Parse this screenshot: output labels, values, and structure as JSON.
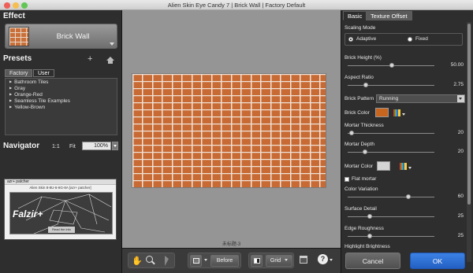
{
  "window": {
    "title": "Alien Skin Eye Candy 7 | Brick Wall | Factory Default"
  },
  "effect": {
    "heading": "Effect",
    "name": "Brick Wall"
  },
  "presets": {
    "heading": "Presets",
    "tabs": [
      "Factory",
      "User"
    ],
    "items": [
      "Bathroom Tiles",
      "Gray",
      "Orange-Red",
      "Seamless Tile Examples",
      "Yellow-Brown"
    ]
  },
  "navigator": {
    "heading": "Navigator",
    "zoom_1to1": "1:1",
    "fit": "Fit",
    "zoom_value": "100%"
  },
  "nav_thumb": {
    "title": "azr+ patcher",
    "subtitle": "Alien Skin 8-8U-6-6G-8A [azr+ patcher]",
    "logo": "Falzir+",
    "caption": "Read the info"
  },
  "canvas": {
    "zoom_label": "未标题-3"
  },
  "bottom_toolbar": {
    "before_label": "Before",
    "grid_label": "Grid"
  },
  "right_tabs": [
    "Basic",
    "Texture Offset"
  ],
  "scaling": {
    "label": "Scaling Mode",
    "adaptive": "Adaptive",
    "fixed": "Fixed",
    "selected": "Adaptive"
  },
  "params": {
    "brick_height": {
      "label": "Brick Height (%)",
      "value": "50.00"
    },
    "aspect_ratio": {
      "label": "Aspect Ratio",
      "value": "2.75"
    },
    "brick_pattern": {
      "label": "Brick Pattern",
      "value": "Running"
    },
    "brick_color": {
      "label": "Brick Color",
      "color": "#c8661f"
    },
    "mortar_thickness": {
      "label": "Mortar Thickness",
      "value": "20"
    },
    "mortar_depth": {
      "label": "Mortar Depth",
      "value": "20"
    },
    "mortar_color": {
      "label": "Mortar Color",
      "color": "#d4d4d4"
    },
    "flat_mortar": {
      "label": "Flat mortar",
      "checked": false
    },
    "color_variation": {
      "label": "Color Variation",
      "value": "60"
    },
    "surface_detail": {
      "label": "Surface Detail",
      "value": "25"
    },
    "edge_roughness": {
      "label": "Edge Roughness",
      "value": "25"
    },
    "highlight_brightness": {
      "label": "Highlight Brightness"
    }
  },
  "actions": {
    "cancel": "Cancel",
    "ok": "OK"
  },
  "colors": {
    "accent": "#2d6fd6",
    "brick": "#c86a33"
  }
}
